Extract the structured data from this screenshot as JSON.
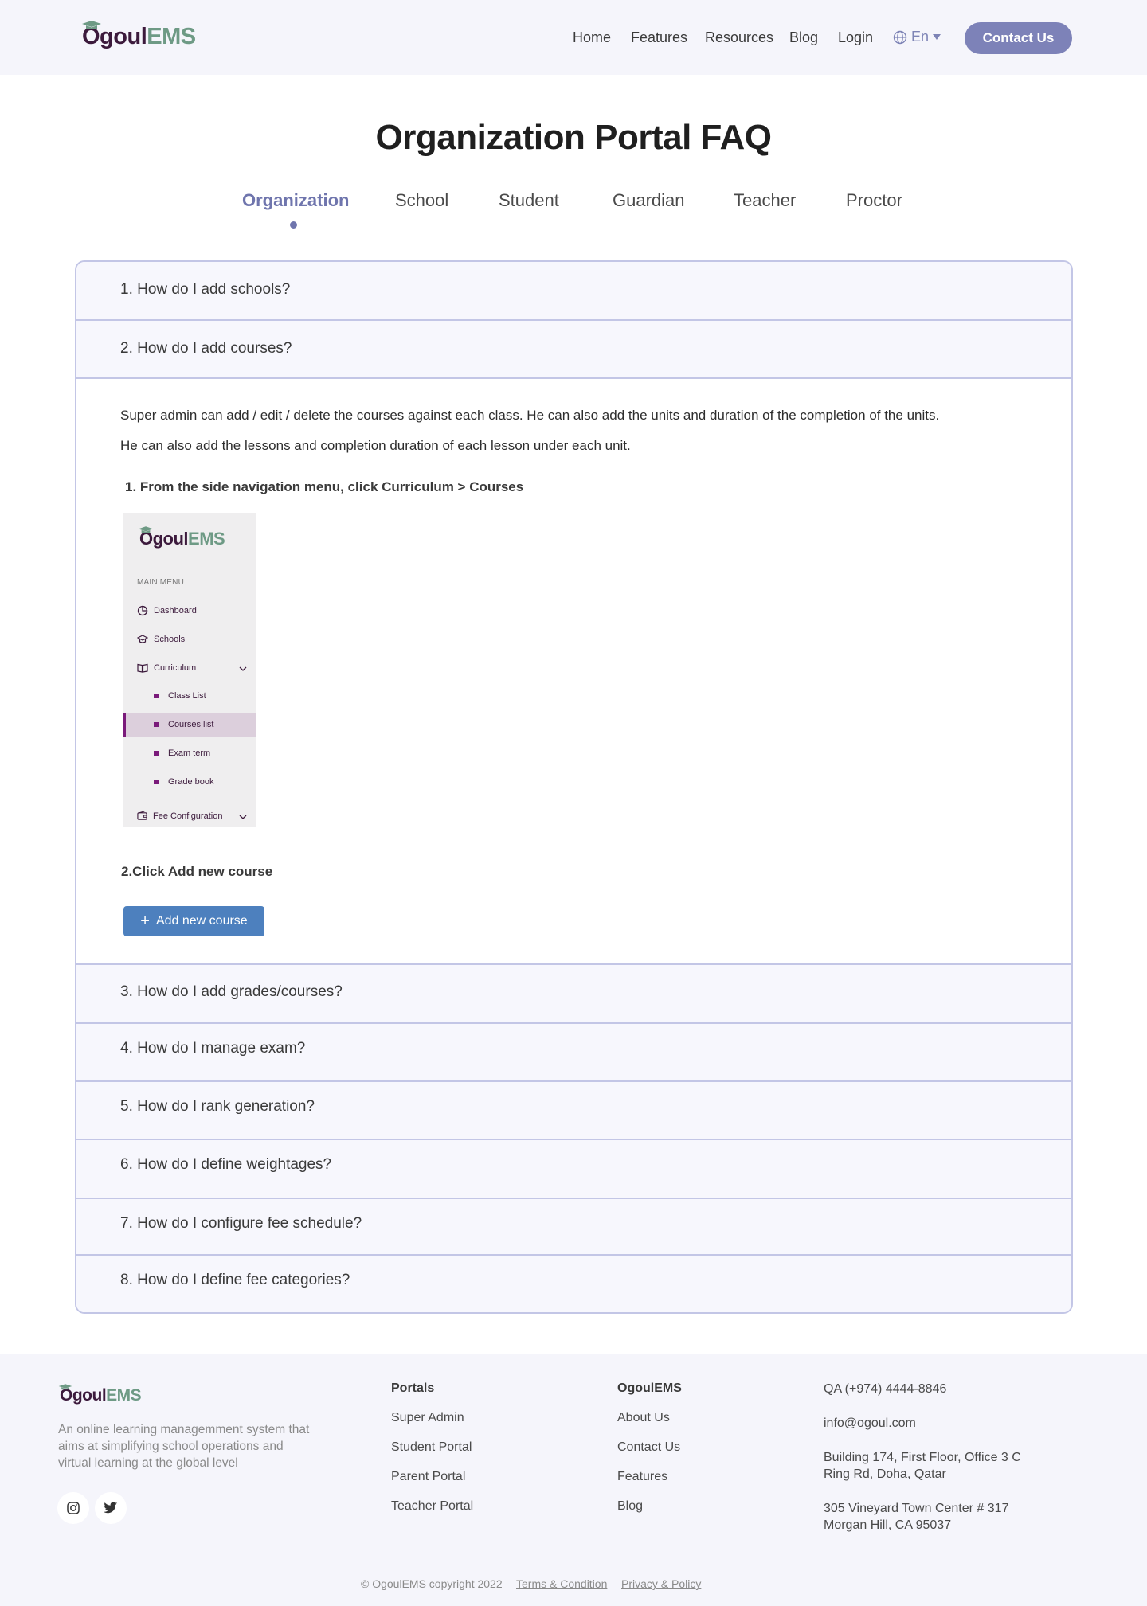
{
  "header": {
    "logo": {
      "part1": "Ogoul",
      "part2": "EMS"
    },
    "nav": [
      "Home",
      "Features",
      "Resources",
      "Blog",
      "Login"
    ],
    "language": "En",
    "contact_button": "Contact Us"
  },
  "page_title": "Organization Portal FAQ",
  "tabs": [
    "Organization",
    "School",
    "Student",
    "Guardian",
    "Teacher",
    "Proctor"
  ],
  "active_tab": "Organization",
  "faq": {
    "questions": [
      "1.  How do I add schools?",
      "2. How do I add courses?",
      "3. How do I add grades/courses?",
      "4. How do I manage exam?",
      "5. How do I rank generation?",
      "6. How do I define weightages?",
      "7. How do I configure fee schedule?",
      "8. How do I define fee categories?"
    ],
    "expanded_index": 1,
    "answer": {
      "para1": "Super admin can add / edit / delete the courses against each class. He can also add the units and duration of the completion of the units.",
      "para2": "He can also add the lessons and completion duration of each lesson under each unit.",
      "step1": "1.  From the side navigation menu, click Curriculum > Courses",
      "step2": "2.Click Add new course",
      "add_button": "Add new course",
      "sidebar_image": {
        "logo": {
          "part1": "Ogoul",
          "part2": "EMS"
        },
        "section": "MAIN MENU",
        "items": [
          "Dashboard",
          "Schools",
          "Curriculum"
        ],
        "curriculum_sub": [
          "Class List",
          "Courses list",
          "Exam term",
          "Grade book"
        ],
        "selected_sub": "Courses list",
        "last_item": "Fee Configuration"
      }
    }
  },
  "footer": {
    "logo": {
      "part1": "Ogoul",
      "part2": "EMS"
    },
    "description": "An online learning managemment system that aims at simplifying school operations and virtual learning at the global level",
    "portals_heading": "Portals",
    "portals": [
      "Super Admin",
      "Student Portal",
      "Parent Portal",
      "Teacher Portal"
    ],
    "company_heading": "OgoulEMS",
    "company_links": [
      "About Us",
      "Contact Us",
      "Features",
      "Blog"
    ],
    "phone": "QA (+974) 4444-8846",
    "email": "info@ogoul.com",
    "address1": "Building 174, First Floor, Office 3 C Ring Rd, Doha, Qatar",
    "address2": "305 Vineyard Town Center # 317 Morgan Hill, CA 95037",
    "copyright": "© OgoulEMS copyright 2022",
    "terms": "Terms & Condition",
    "privacy": "Privacy & Policy"
  },
  "colors": {
    "accent": "#7d82b8",
    "tab_active": "#6f75ad",
    "border": "#c3c6e6",
    "button_blue": "#4d80be",
    "logo_dark": "#3c1a3c",
    "logo_green": "#6e9a85"
  }
}
